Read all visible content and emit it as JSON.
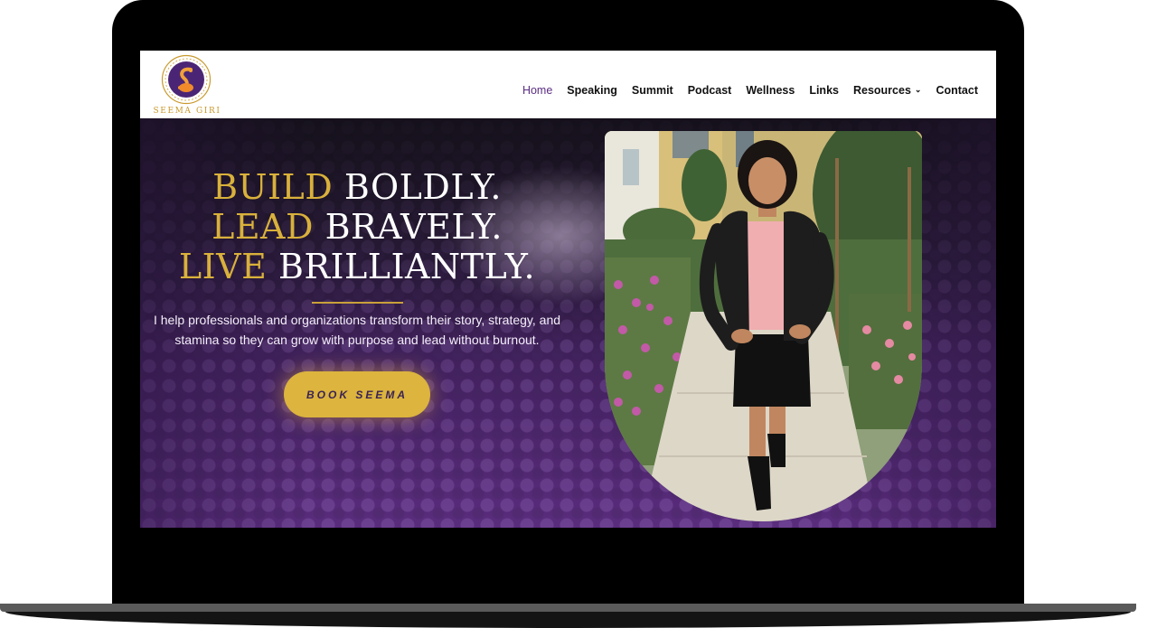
{
  "site": {
    "logo_text": "SEEMA GIRI",
    "nav": [
      {
        "label": "Home",
        "active": true
      },
      {
        "label": "Speaking"
      },
      {
        "label": "Summit"
      },
      {
        "label": "Podcast"
      },
      {
        "label": "Wellness"
      },
      {
        "label": "Links"
      },
      {
        "label": "Resources",
        "dropdown": true
      },
      {
        "label": "Contact"
      }
    ]
  },
  "hero": {
    "line1_gold": "BUILD",
    "line1_white": "BOLDLY.",
    "line2_gold": "LEAD",
    "line2_white": "BRAVELY.",
    "line3_gold": "LIVE",
    "line3_white": "BRILLIANTLY.",
    "subtext_line1": "I help professionals and organizations transform their story, strategy, and",
    "subtext_line2": "stamina so they can grow with purpose and lead without burnout.",
    "cta_label": "BOOK SEEMA"
  },
  "icons": {
    "chevron": "chevron-down-icon",
    "logo": "swan-logo-icon"
  },
  "colors": {
    "brand_purple": "#5b2d83",
    "gold": "#d9b13b",
    "cta_bg": "#dcb43e",
    "logo_gold": "#c99a2e"
  }
}
